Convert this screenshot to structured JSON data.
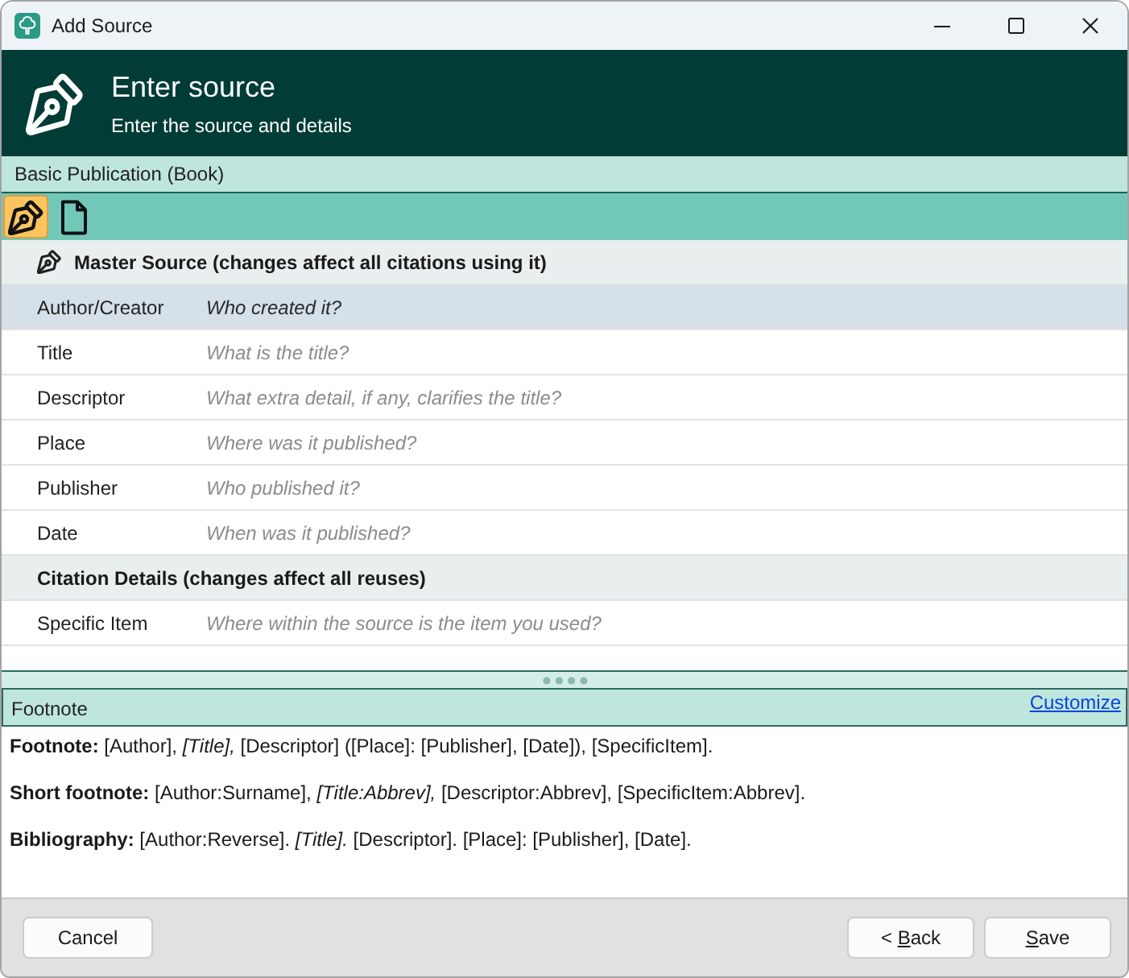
{
  "window": {
    "title": "Add Source"
  },
  "header": {
    "title": "Enter source",
    "subtitle": "Enter the source and details"
  },
  "template": {
    "label": "Basic Publication (Book)"
  },
  "toolbar": {
    "tools": [
      {
        "kind": "pen",
        "selected": true
      },
      {
        "kind": "document",
        "selected": false
      }
    ]
  },
  "sections": [
    {
      "kind": "master",
      "title": "Master Source (changes affect all citations using it)",
      "fields": [
        {
          "label": "Author/Creator",
          "placeholder": "Who created it?",
          "selected": true
        },
        {
          "label": "Title",
          "placeholder": "What is the title?",
          "selected": false
        },
        {
          "label": "Descriptor",
          "placeholder": "What extra detail, if any, clarifies the title?",
          "selected": false
        },
        {
          "label": "Place",
          "placeholder": "Where was it published?",
          "selected": false
        },
        {
          "label": "Publisher",
          "placeholder": "Who published it?",
          "selected": false
        },
        {
          "label": "Date",
          "placeholder": "When was it published?",
          "selected": false
        }
      ]
    },
    {
      "kind": "citation",
      "title": "Citation Details (changes affect all reuses)",
      "fields": [
        {
          "label": "Specific Item",
          "placeholder": "Where within the source is the item you used?",
          "selected": false
        }
      ]
    }
  ],
  "footnote_panel": {
    "title": "Footnote",
    "link": "Customize",
    "lines": [
      "**Footnote:** [Author], *[Title],* [Descriptor] ([Place]: [Publisher], [Date]), [SpecificItem].",
      "**Short footnote:** [Author:Surname], *[Title:Abbrev],* [Descriptor:Abbrev], [SpecificItem:Abbrev].",
      "**Bibliography:** [Author:Reverse]. *[Title].* [Descriptor]. [Place]: [Publisher], [Date]."
    ]
  },
  "buttons": {
    "left": [
      {
        "label": "Cancel",
        "access_key_shown": false
      }
    ],
    "right": [
      {
        "label": "< Back",
        "access_key_shown": true
      },
      {
        "label": "Save",
        "access_key_shown": true
      }
    ]
  }
}
